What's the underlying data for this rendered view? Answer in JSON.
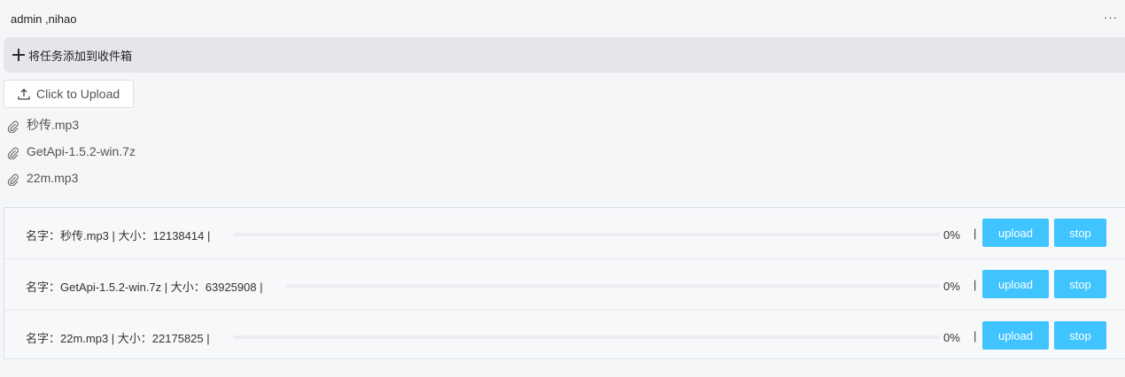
{
  "header": {
    "user_label": "admin ,nihao",
    "more_label": "···"
  },
  "add_task": {
    "label": "将任务添加到收件箱"
  },
  "upload": {
    "button_label": "Click to Upload"
  },
  "files": [
    {
      "name": "秒传.mp3"
    },
    {
      "name": "GetApi-1.5.2-win.7z"
    },
    {
      "name": "22m.mp3"
    }
  ],
  "tasks": [
    {
      "info": "名字：秒传.mp3 | 大小：12138414 |",
      "percent": "0%",
      "progress": 0,
      "separator": "|",
      "upload_label": "upload",
      "stop_label": "stop"
    },
    {
      "info": "名字：GetApi-1.5.2-win.7z | 大小：63925908 |",
      "percent": "0%",
      "progress": 0,
      "separator": "|",
      "upload_label": "upload",
      "stop_label": "stop"
    },
    {
      "info": "名字：22m.mp3 | 大小：22175825 |",
      "percent": "0%",
      "progress": 0,
      "separator": "|",
      "upload_label": "upload",
      "stop_label": "stop"
    }
  ],
  "colors": {
    "accent": "#40c4ff",
    "background": "#f5f6f8",
    "bar": "#e4e6ea"
  }
}
